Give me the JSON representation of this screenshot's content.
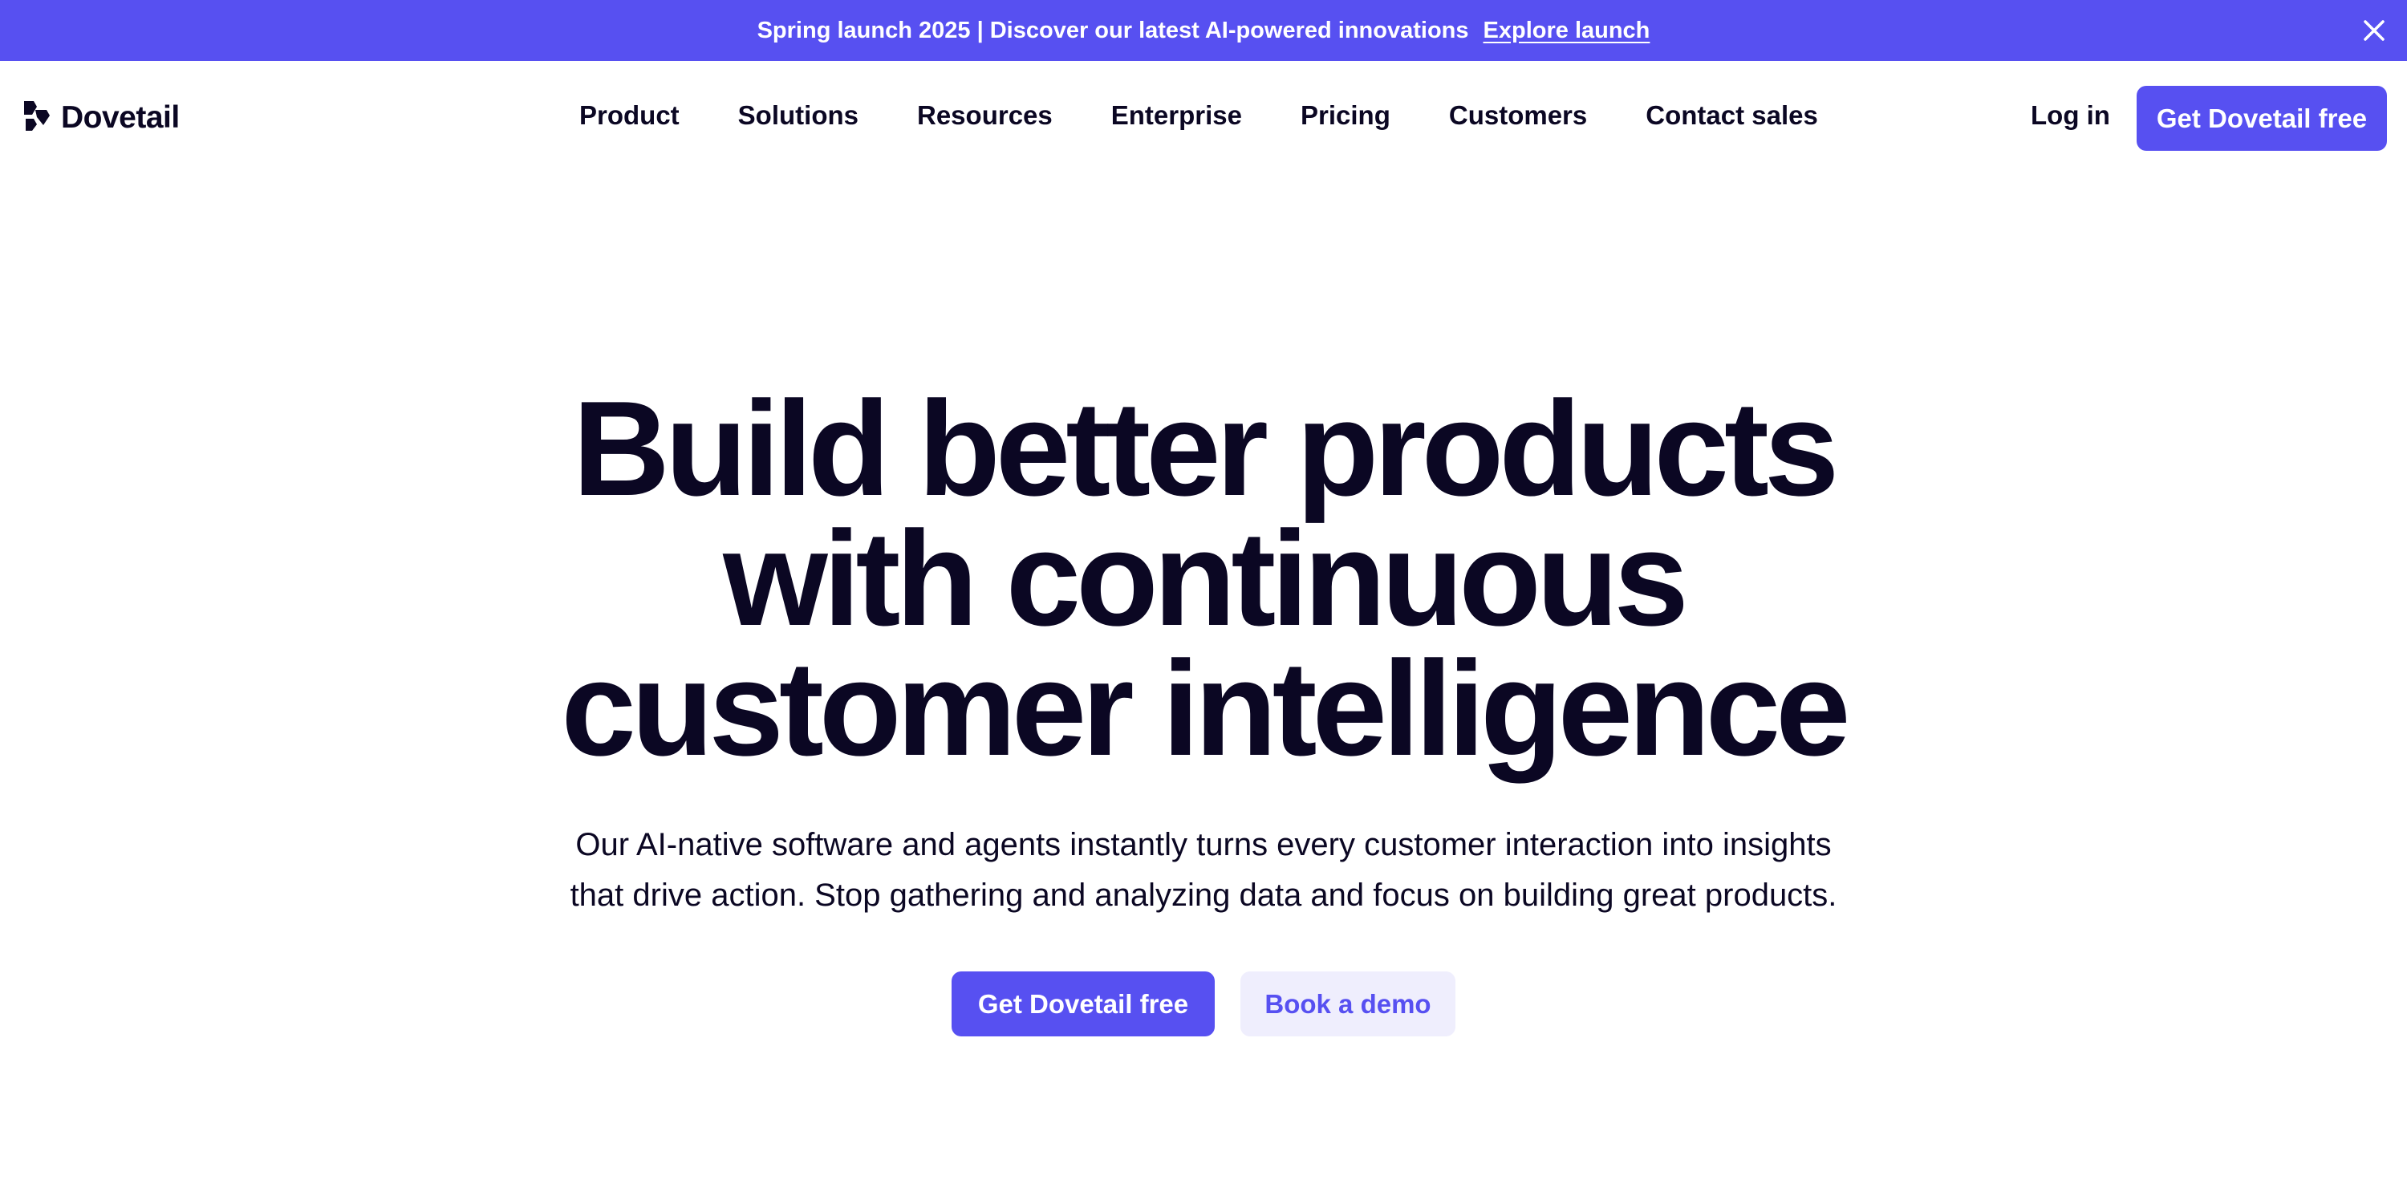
{
  "announcement": {
    "message": "Spring launch 2025 | Discover our latest AI-powered innovations",
    "link_label": "Explore launch",
    "close_icon": "close-icon"
  },
  "brand": {
    "name": "Dovetail",
    "logo_icon": "dovetail-logo-icon",
    "accent_color": "#5750f1"
  },
  "nav": {
    "items": [
      {
        "label": "Product"
      },
      {
        "label": "Solutions"
      },
      {
        "label": "Resources"
      },
      {
        "label": "Enterprise"
      },
      {
        "label": "Pricing"
      },
      {
        "label": "Customers"
      },
      {
        "label": "Contact sales"
      }
    ],
    "login_label": "Log in",
    "cta_label": "Get Dovetail free"
  },
  "hero": {
    "title_lines": [
      "Build better products",
      "with continuous",
      "customer intelligence"
    ],
    "subtitle_lines": [
      "Our AI-native software and agents instantly turns every customer interaction into insights",
      "that drive action. Stop gathering and analyzing data and focus on building great products."
    ],
    "primary_cta": "Get Dovetail free",
    "secondary_cta": "Book a demo"
  }
}
